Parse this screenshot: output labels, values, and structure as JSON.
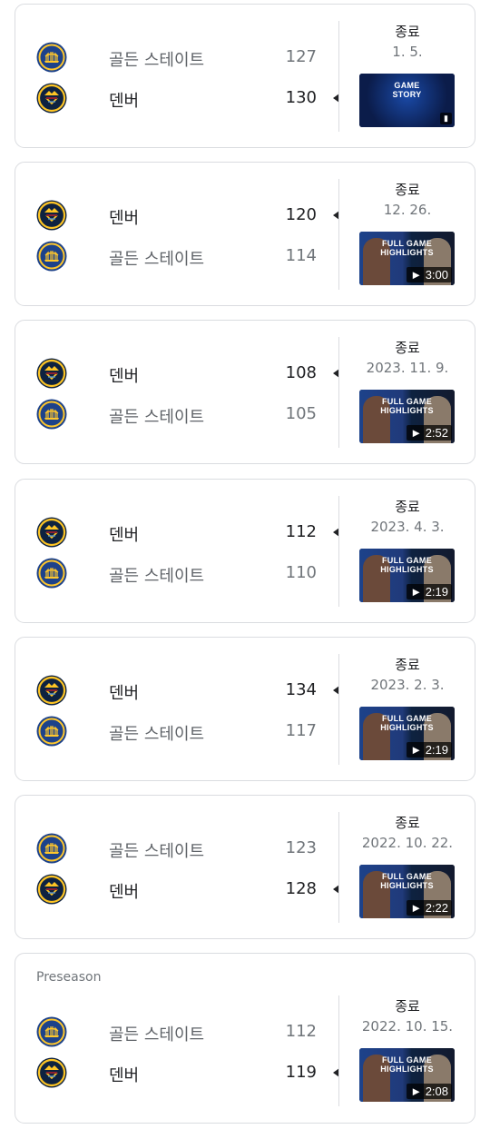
{
  "colors": {
    "gsw_blue": "#1d428a",
    "gsw_gold": "#ffc72c",
    "den_navy": "#0e2240",
    "den_gold": "#fec524",
    "den_red": "#8b2131"
  },
  "games": [
    {
      "label": "",
      "status": "종료",
      "date": "1. 5.",
      "teams": [
        {
          "name": "골든 스테이트",
          "score": "127",
          "logo": "warriors-logo",
          "winner": false
        },
        {
          "name": "덴버",
          "score": "130",
          "logo": "nuggets-logo",
          "winner": true
        }
      ],
      "thumb": {
        "title": "GAME\nSTORY",
        "duration": "",
        "style": "story"
      }
    },
    {
      "label": "",
      "status": "종료",
      "date": "12. 26.",
      "teams": [
        {
          "name": "덴버",
          "score": "120",
          "logo": "nuggets-logo",
          "winner": true
        },
        {
          "name": "골든 스테이트",
          "score": "114",
          "logo": "warriors-logo",
          "winner": false
        }
      ],
      "thumb": {
        "title": "FULL GAME\nHIGHLIGHTS",
        "duration": "3:00",
        "style": "highlight"
      }
    },
    {
      "label": "",
      "status": "종료",
      "date": "2023. 11. 9.",
      "teams": [
        {
          "name": "덴버",
          "score": "108",
          "logo": "nuggets-logo",
          "winner": true
        },
        {
          "name": "골든 스테이트",
          "score": "105",
          "logo": "warriors-logo",
          "winner": false
        }
      ],
      "thumb": {
        "title": "FULL GAME\nHIGHLIGHTS",
        "duration": "2:52",
        "style": "highlight"
      }
    },
    {
      "label": "",
      "status": "종료",
      "date": "2023. 4. 3.",
      "teams": [
        {
          "name": "덴버",
          "score": "112",
          "logo": "nuggets-logo",
          "winner": true
        },
        {
          "name": "골든 스테이트",
          "score": "110",
          "logo": "warriors-logo",
          "winner": false
        }
      ],
      "thumb": {
        "title": "FULL GAME\nHIGHLIGHTS",
        "duration": "2:19",
        "style": "highlight"
      }
    },
    {
      "label": "",
      "status": "종료",
      "date": "2023. 2. 3.",
      "teams": [
        {
          "name": "덴버",
          "score": "134",
          "logo": "nuggets-logo",
          "winner": true
        },
        {
          "name": "골든 스테이트",
          "score": "117",
          "logo": "warriors-logo",
          "winner": false
        }
      ],
      "thumb": {
        "title": "FULL GAME\nHIGHLIGHTS",
        "duration": "2:19",
        "style": "highlight"
      }
    },
    {
      "label": "",
      "status": "종료",
      "date": "2022. 10. 22.",
      "teams": [
        {
          "name": "골든 스테이트",
          "score": "123",
          "logo": "warriors-logo",
          "winner": false
        },
        {
          "name": "덴버",
          "score": "128",
          "logo": "nuggets-logo",
          "winner": true
        }
      ],
      "thumb": {
        "title": "FULL GAME\nHIGHLIGHTS",
        "duration": "2:22",
        "style": "highlight"
      }
    },
    {
      "label": "Preseason",
      "status": "종료",
      "date": "2022. 10. 15.",
      "teams": [
        {
          "name": "골든 스테이트",
          "score": "112",
          "logo": "warriors-logo",
          "winner": false
        },
        {
          "name": "덴버",
          "score": "119",
          "logo": "nuggets-logo",
          "winner": true
        }
      ],
      "thumb": {
        "title": "FULL GAME\nHIGHLIGHTS",
        "duration": "2:08",
        "style": "highlight"
      }
    }
  ]
}
